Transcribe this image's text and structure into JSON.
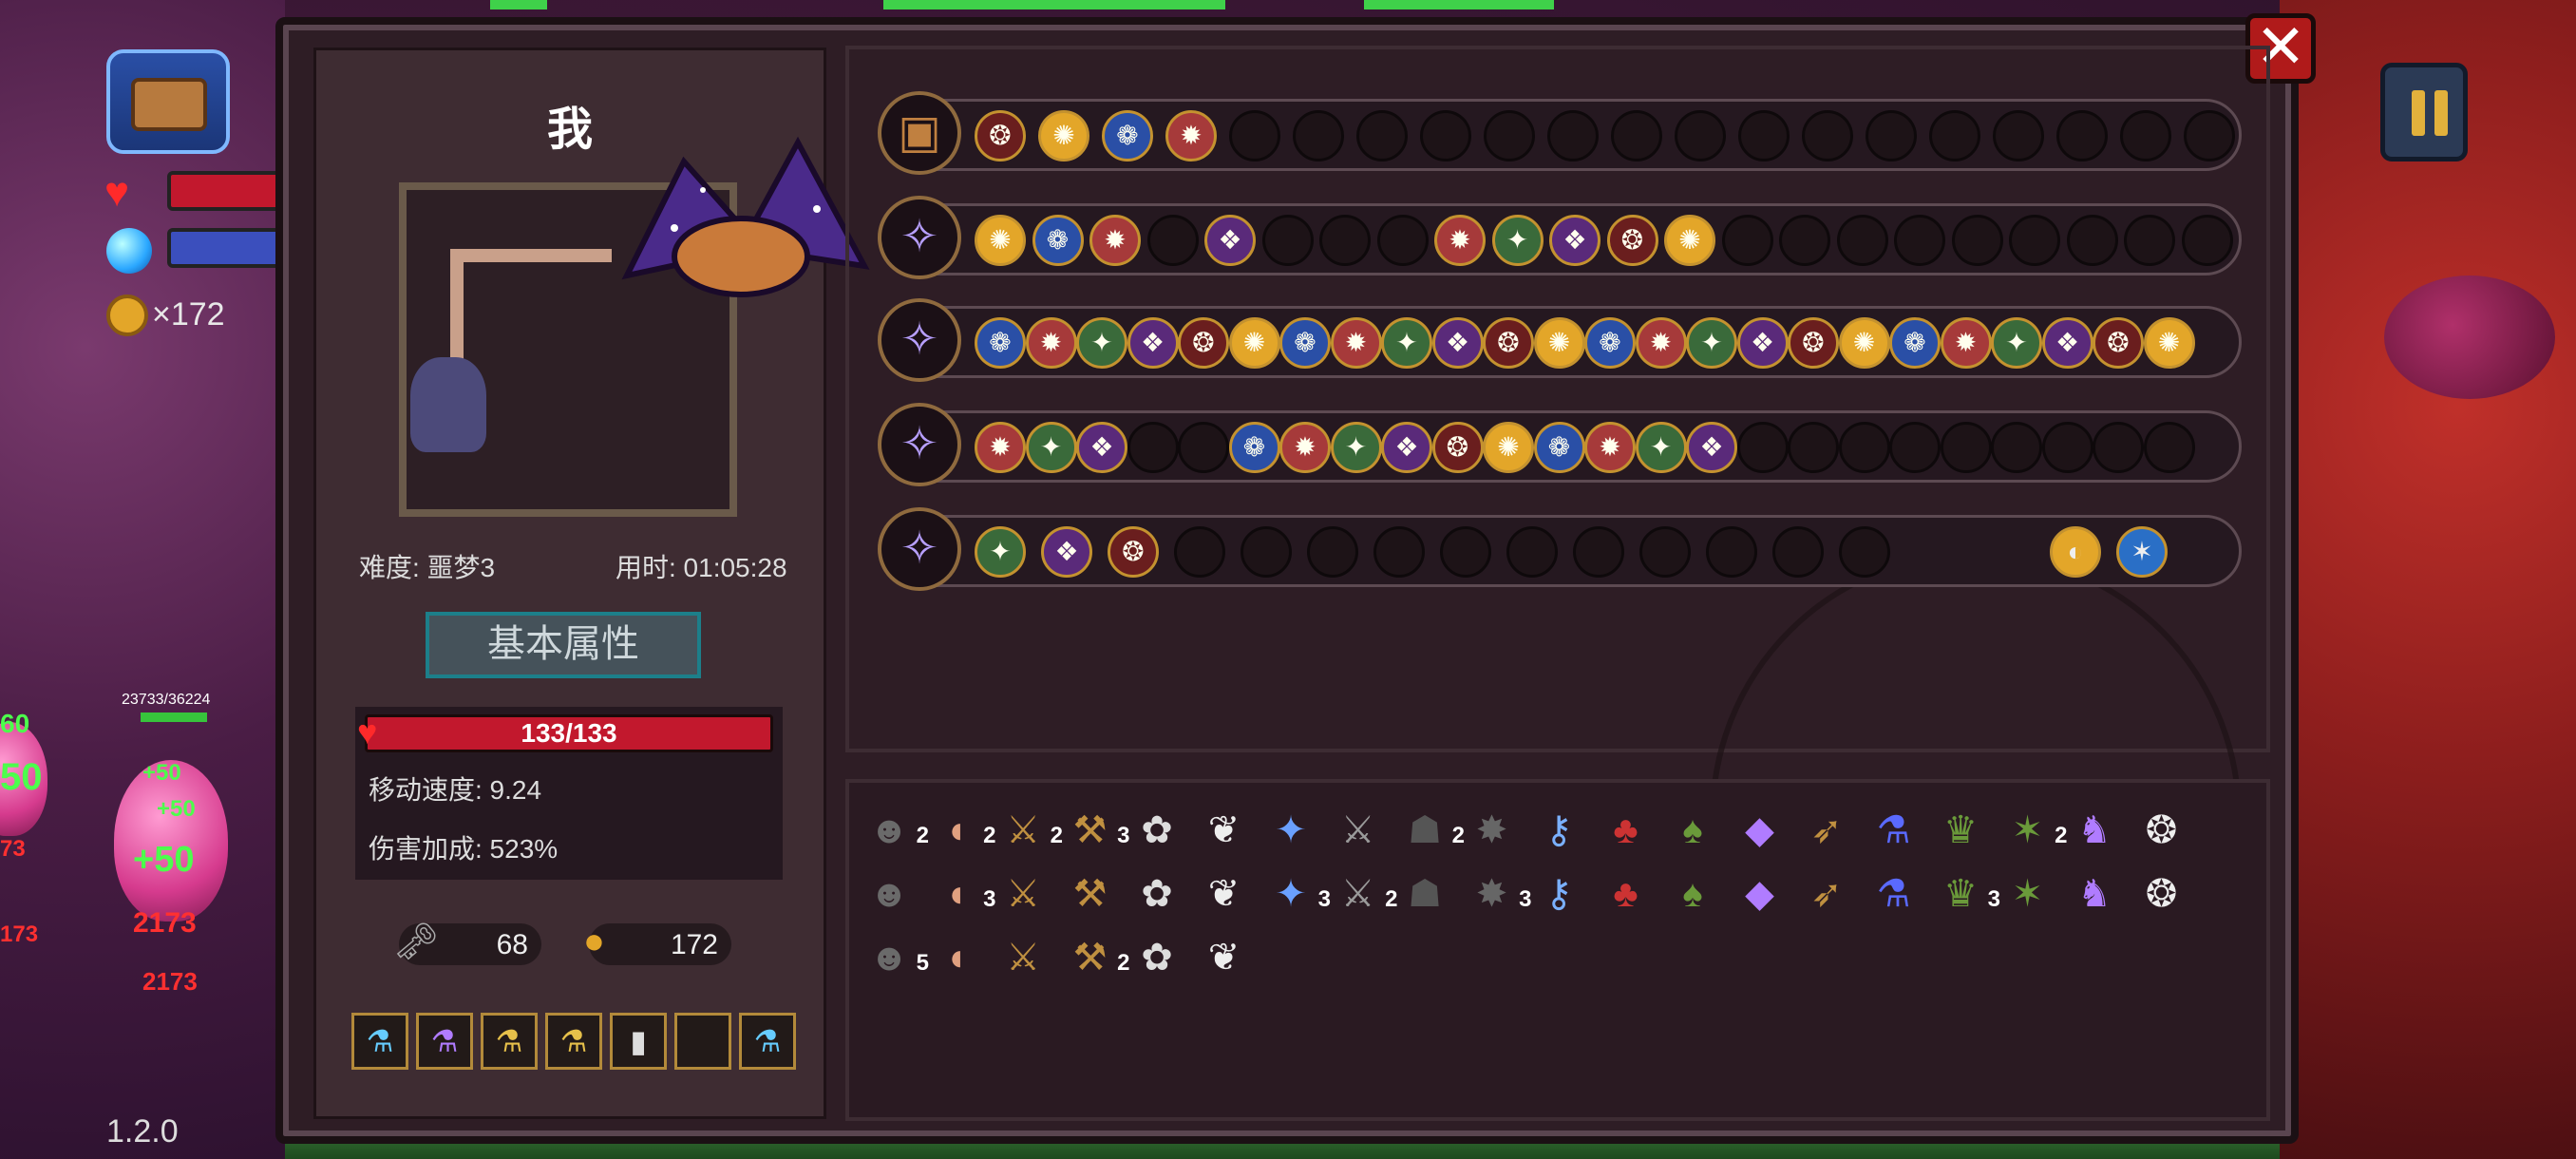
{
  "hud": {
    "coin_text": "×172",
    "version": "1.2.0",
    "enemy_hp": "23733/36224"
  },
  "panel": {
    "close_label": "✕",
    "player_name": "我",
    "difficulty": "难度: 噩梦3",
    "time_used": "用时: 01:05:28",
    "attr_tab": "基本属性",
    "hp": "133/133",
    "move_speed": "移动速度: 9.24",
    "damage_bonus": "伤害加成: 523%",
    "keys": "68",
    "coins": "172"
  },
  "floating_numbers": [
    "+50",
    "+50",
    "+50",
    "2173",
    "2173",
    "173",
    "73",
    "60",
    "50"
  ],
  "inventory_counts": [
    "2",
    "2",
    "2",
    "3",
    "2",
    "2",
    "3",
    "3",
    "2",
    "3",
    "3",
    "5",
    "2"
  ],
  "colors": {
    "hp_red": "#c2182d",
    "gold_border": "#c4922f",
    "close_red": "#b01a1a",
    "tab_teal": "#1c7f8a"
  }
}
